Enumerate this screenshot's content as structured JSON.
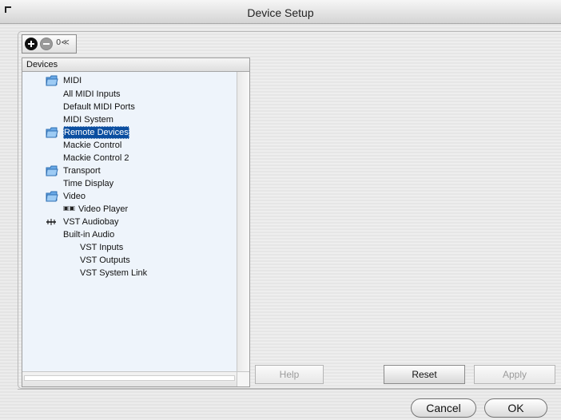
{
  "window": {
    "title": "Device Setup"
  },
  "toolbar": {
    "add_icon": "add-icon",
    "remove_icon": "remove-icon",
    "reset_label": "0≪"
  },
  "devices_panel": {
    "header": "Devices",
    "items": [
      {
        "label": "MIDI",
        "icon": "folder-icon",
        "selected": false
      },
      {
        "label": "All MIDI Inputs",
        "icon": "",
        "selected": false
      },
      {
        "label": "Default MIDI Ports",
        "icon": "",
        "selected": false
      },
      {
        "label": "MIDI System",
        "icon": "",
        "selected": false
      },
      {
        "label": "Remote Devices",
        "icon": "folder-icon",
        "selected": true
      },
      {
        "label": "Mackie Control",
        "icon": "",
        "selected": false
      },
      {
        "label": "Mackie Control 2",
        "icon": "",
        "selected": false
      },
      {
        "label": "Transport",
        "icon": "folder-icon",
        "selected": false
      },
      {
        "label": "Time Display",
        "icon": "",
        "selected": false
      },
      {
        "label": "Video",
        "icon": "folder-icon",
        "selected": false
      },
      {
        "label": "Video Player",
        "icon": "video-player-icon",
        "selected": false
      },
      {
        "label": "VST Audiobay",
        "icon": "vst-audiobay-icon",
        "selected": false
      },
      {
        "label": "Built-in Audio",
        "icon": "",
        "selected": false
      },
      {
        "label": "VST Inputs",
        "icon": "",
        "selected": false
      },
      {
        "label": "VST Outputs",
        "icon": "",
        "selected": false
      },
      {
        "label": "VST System Link",
        "icon": "",
        "selected": false
      }
    ]
  },
  "panel_buttons": {
    "help": "Help",
    "reset": "Reset",
    "apply": "Apply"
  },
  "dialog_buttons": {
    "cancel": "Cancel",
    "ok": "OK"
  },
  "colors": {
    "selection": "#0b4ea0",
    "tree_background": "#eef4fb",
    "folder_blue": "#69a8e6"
  }
}
